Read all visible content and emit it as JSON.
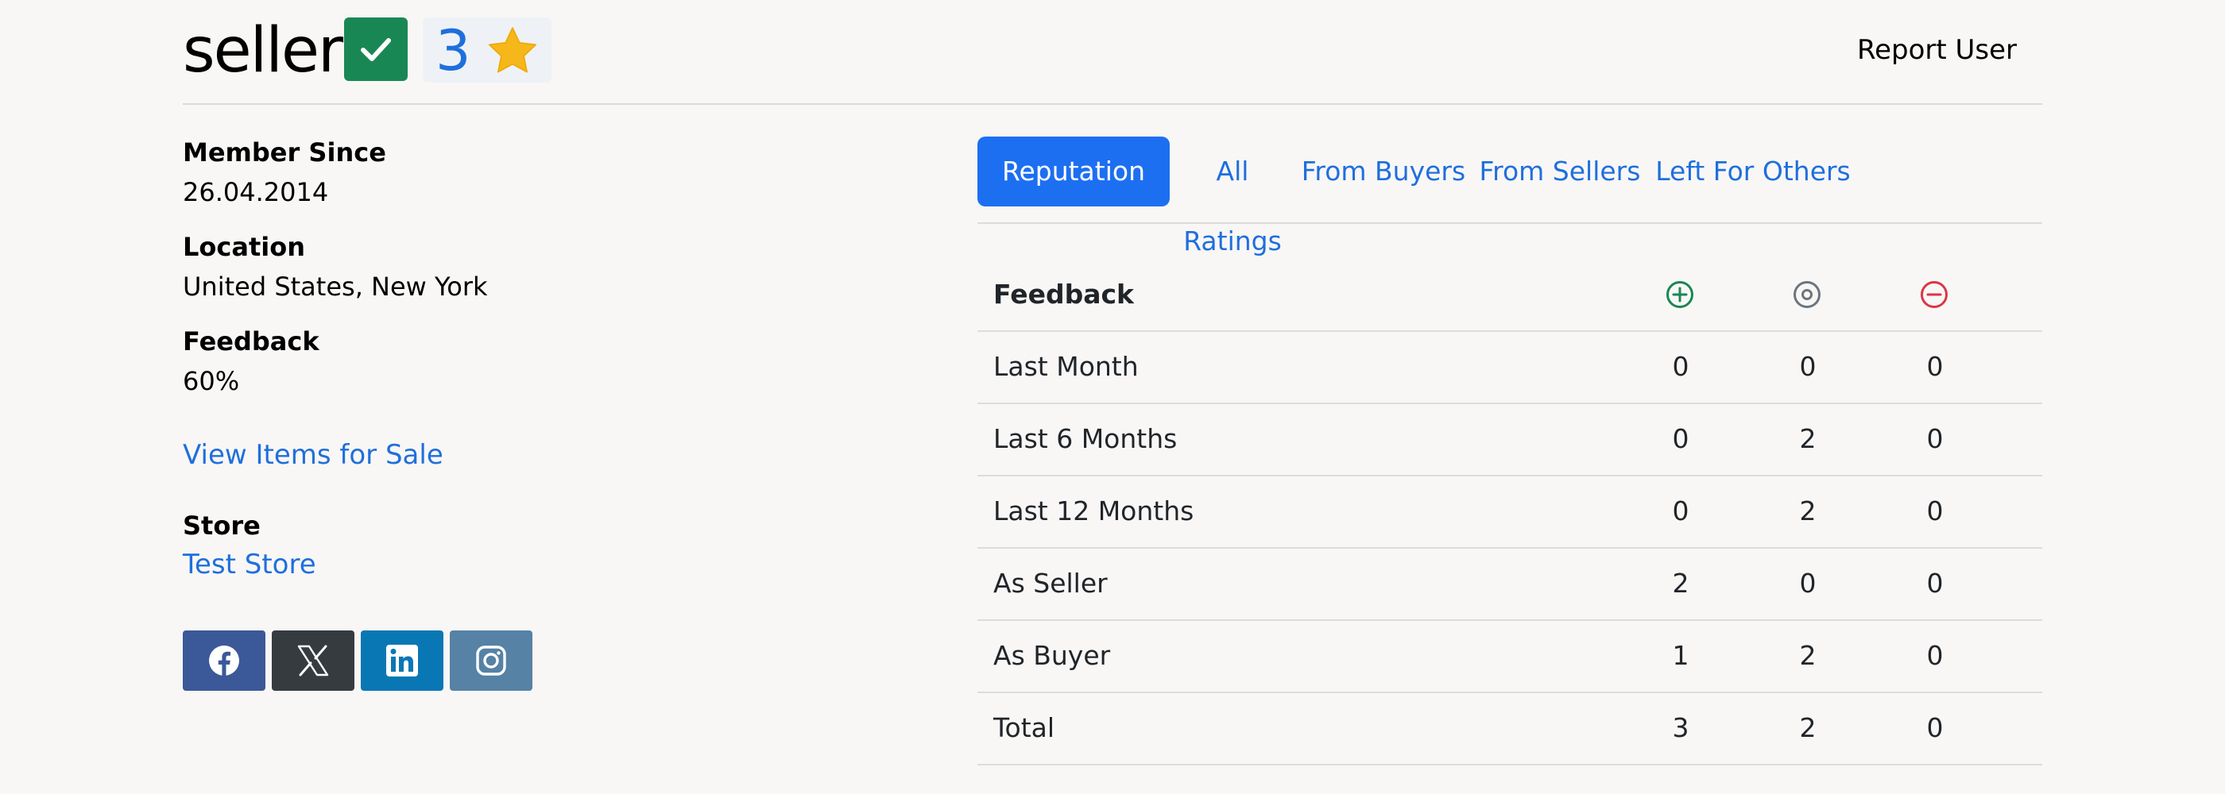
{
  "header": {
    "username": "seller",
    "rating_count": "3",
    "report_label": "Report User"
  },
  "profile": {
    "member_since_label": "Member Since",
    "member_since_value": "26.04.2014",
    "location_label": "Location",
    "location_value": "United States, New York",
    "feedback_label": "Feedback",
    "feedback_value": "60%",
    "view_items_link": "View Items for Sale",
    "store_label": "Store",
    "store_link": "Test Store"
  },
  "socials": [
    {
      "name": "facebook",
      "color": "#3b5998"
    },
    {
      "name": "x",
      "color": "#363b40"
    },
    {
      "name": "linkedin",
      "color": "#0a77b5"
    },
    {
      "name": "instagram",
      "color": "#5582a5"
    }
  ],
  "tabs": [
    {
      "label": "Reputation",
      "active": true
    },
    {
      "label": "All Ratings",
      "active": false
    },
    {
      "label": "From Buyers",
      "active": false
    },
    {
      "label": "From Sellers",
      "active": false
    },
    {
      "label": "Left For Others",
      "active": false
    }
  ],
  "feedback_table": {
    "header": "Feedback",
    "column_icons": [
      "plus-circle-icon",
      "dot-circle-icon",
      "minus-circle-icon"
    ],
    "icon_colors": [
      "#198754",
      "#6c757d",
      "#dc3545"
    ],
    "rows": [
      {
        "label": "Last Month",
        "positive": "0",
        "neutral": "0",
        "negative": "0"
      },
      {
        "label": "Last 6 Months",
        "positive": "0",
        "neutral": "2",
        "negative": "0"
      },
      {
        "label": "Last 12 Months",
        "positive": "0",
        "neutral": "2",
        "negative": "0"
      },
      {
        "label": "As Seller",
        "positive": "2",
        "neutral": "0",
        "negative": "0"
      },
      {
        "label": "As Buyer",
        "positive": "1",
        "neutral": "2",
        "negative": "0"
      },
      {
        "label": "Total",
        "positive": "3",
        "neutral": "2",
        "negative": "0"
      }
    ]
  },
  "colors": {
    "accent": "#1d6ff1",
    "link": "#1f6fdc",
    "verified": "#198754",
    "star": "#f5b71a"
  }
}
